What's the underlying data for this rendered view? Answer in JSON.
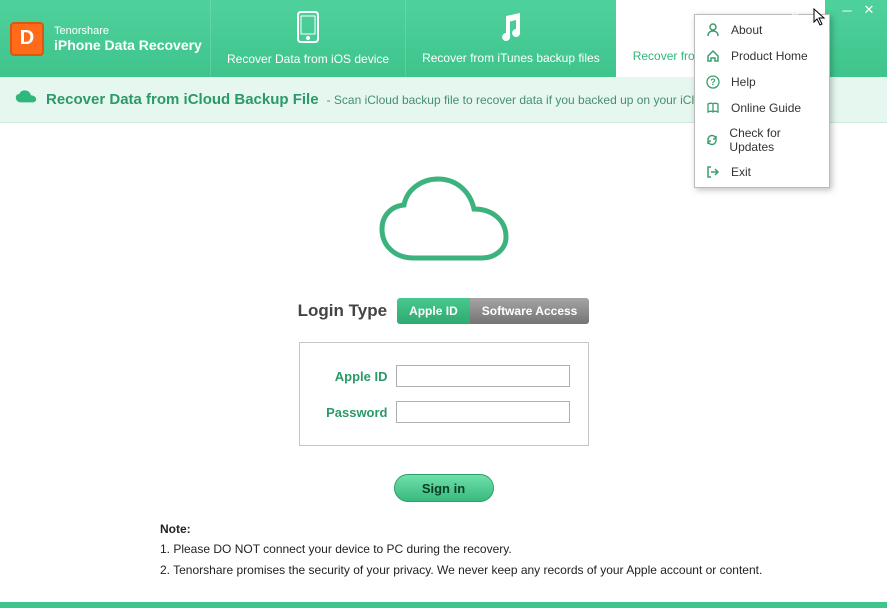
{
  "brand": "Tenorshare",
  "appTitle": "iPhone Data Recovery",
  "tabs": {
    "ios": "Recover Data from iOS device",
    "itunes": "Recover from iTunes backup files",
    "icloud": "Recover from iCloud backup files"
  },
  "subheader": {
    "title": "Recover Data from iCloud Backup File",
    "desc": " -  Scan iCloud backup file to recover data if you backed up on your iCloud account"
  },
  "loginType": {
    "label": "Login Type",
    "appleId": "Apple ID",
    "softwareAccess": "Software Access"
  },
  "form": {
    "appleIdLabel": "Apple ID",
    "passwordLabel": "Password",
    "appleIdValue": "",
    "passwordValue": ""
  },
  "signInLabel": "Sign in",
  "notes": {
    "title": "Note:",
    "line1": "1. Please DO NOT connect your device to PC during the recovery.",
    "line2": "2. Tenorshare promises the security of your privacy. We never keep any records of your Apple account or content."
  },
  "menu": {
    "about": "About",
    "home": "Product Home",
    "help": "Help",
    "guide": "Online Guide",
    "updates": "Check for Updates",
    "exit": "Exit"
  }
}
